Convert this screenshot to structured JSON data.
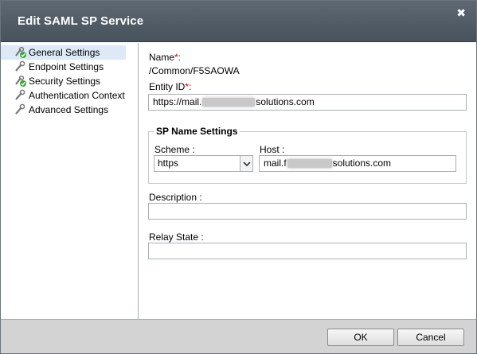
{
  "dialog": {
    "title": "Edit SAML SP Service",
    "close_glyph": "✖"
  },
  "nav": {
    "items": [
      {
        "label": "General Settings",
        "icon": "settings-check-icon",
        "selected": true
      },
      {
        "label": "Endpoint Settings",
        "icon": "wrench-icon",
        "selected": false
      },
      {
        "label": "Security Settings",
        "icon": "settings-check-icon",
        "selected": false
      },
      {
        "label": "Authentication Context",
        "icon": "wrench-icon",
        "selected": false
      },
      {
        "label": "Advanced Settings",
        "icon": "wrench-icon",
        "selected": false
      }
    ]
  },
  "form": {
    "name_label": "Name",
    "name_req": "*:",
    "name_value": "/Common/F5SAOWA",
    "entity_label": "Entity ID",
    "entity_req": "*:",
    "entity_prefix": "https://mail.",
    "entity_suffix": "solutions.com",
    "sp_name_legend": "SP Name Settings",
    "scheme_label": "Scheme :",
    "scheme_value": "https",
    "host_label": "Host :",
    "host_prefix": "mail.f",
    "host_suffix": "solutions.com",
    "description_label": "Description :",
    "description_value": "",
    "relay_label": "Relay State :",
    "relay_value": ""
  },
  "footer": {
    "ok_label": "OK",
    "cancel_label": "Cancel"
  },
  "colors": {
    "titlebar": "#515b65",
    "selected_nav": "#dde9f6",
    "required": "#cc0000",
    "footer": "#d3d3d3"
  }
}
